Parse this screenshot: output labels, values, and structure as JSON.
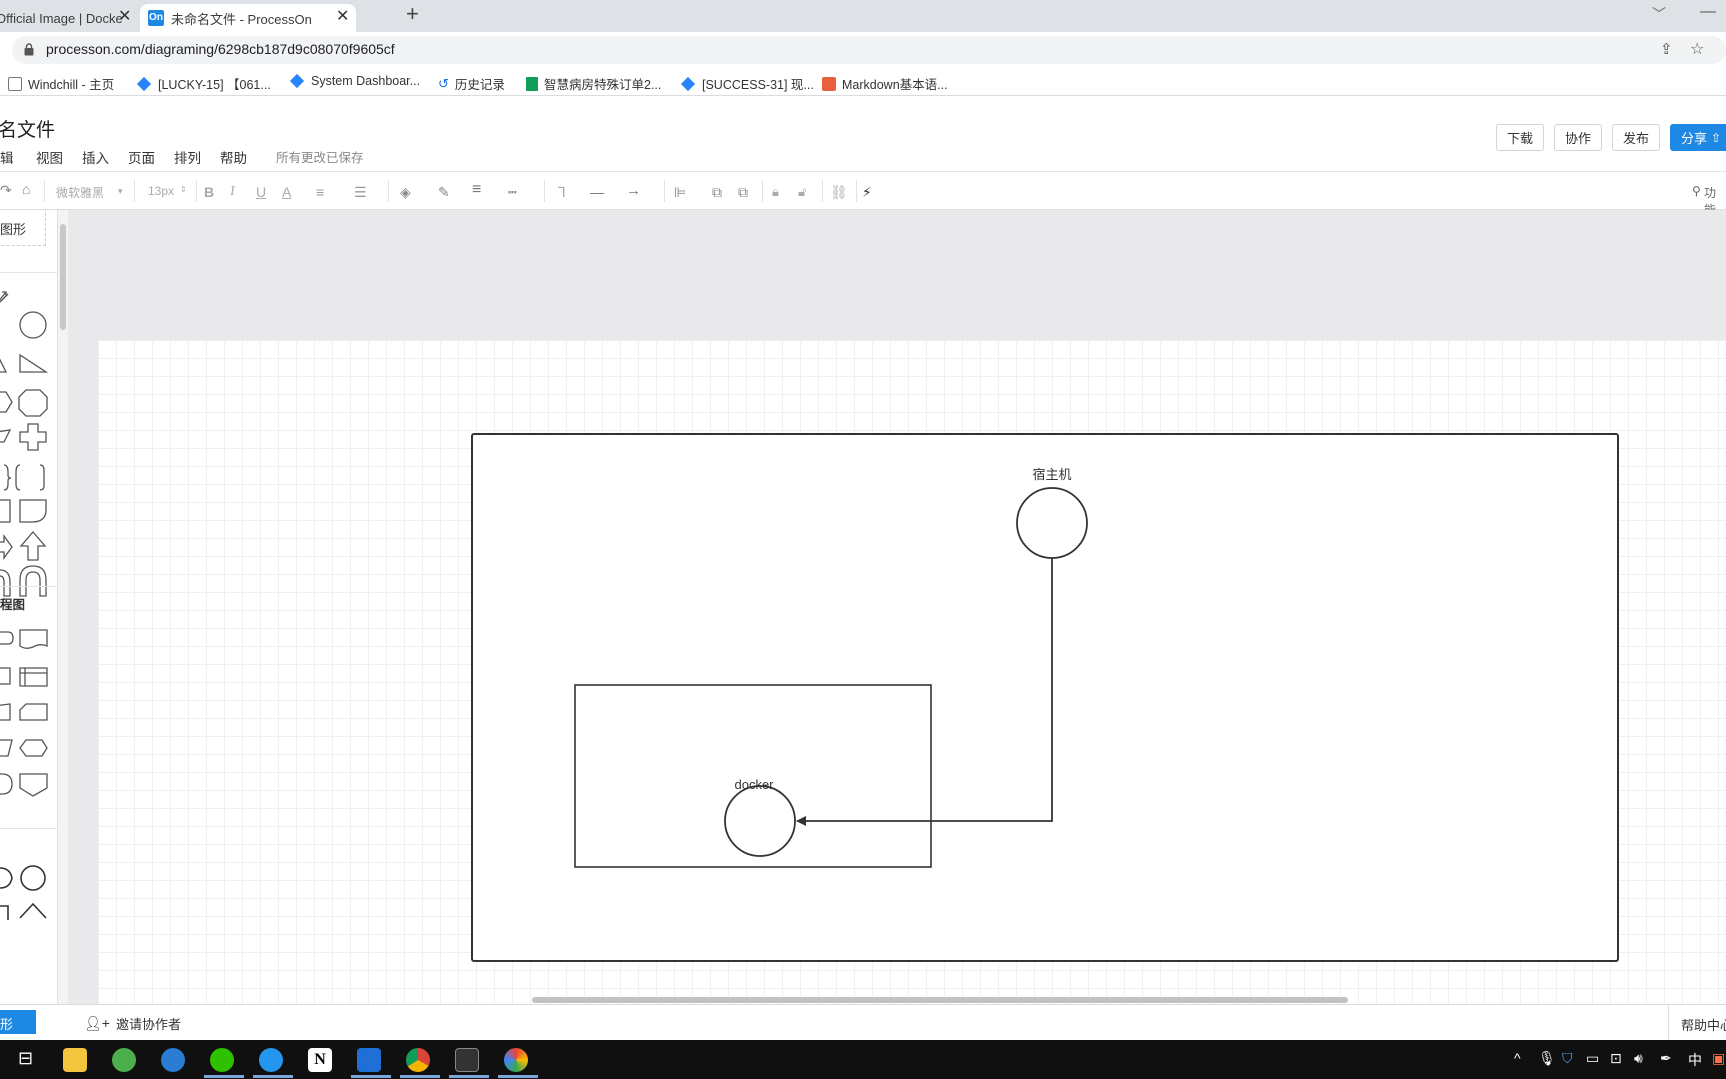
{
  "browser": {
    "tabs": [
      {
        "title": "Official Image | Docke",
        "active": false
      },
      {
        "title": "未命名文件 - ProcessOn",
        "active": true,
        "favicon_text": "On"
      }
    ],
    "new_tab": "+",
    "url": "processon.com/diagraming/6298cb187d9c08070f9605cf",
    "bookmarks": [
      {
        "label": "Windchill - 主页",
        "icon": "windchill-icon"
      },
      {
        "label": "[LUCKY-15] 【061...",
        "icon": "jira-diamond-icon"
      },
      {
        "label": "System Dashboar...",
        "icon": "jira-diamond-icon"
      },
      {
        "label": "历史记录",
        "icon": "history-icon"
      },
      {
        "label": "智慧病房特殊订单2...",
        "icon": "sheet-icon"
      },
      {
        "label": "[SUCCESS-31] 现...",
        "icon": "jira-diamond-icon"
      },
      {
        "label": "Markdown基本语...",
        "icon": "note-icon"
      }
    ]
  },
  "app": {
    "file_title": "名文件",
    "menus": [
      "辑",
      "视图",
      "插入",
      "页面",
      "排列",
      "帮助"
    ],
    "save_status": "所有更改已保存",
    "buttons": {
      "download": "下载",
      "collaborate": "协作",
      "publish": "发布",
      "share": "分享"
    },
    "toolbar": {
      "font": "微软雅黑",
      "font_size": "13px",
      "search": "功能"
    },
    "left_panel": {
      "custom_shape": "图形",
      "section_flowchart": "程图",
      "bottom_tab": "形"
    },
    "statusbar": {
      "invite": "邀请协作者",
      "help": "帮助中心"
    }
  },
  "diagram": {
    "host_label": "宿主机",
    "docker_label": "docker"
  },
  "taskbar": {
    "tray": {
      "ime": "中"
    }
  },
  "colors": {
    "accent": "#1e88e5",
    "taskbar": "#101010",
    "canvas_bg": "#e9e9eb"
  }
}
